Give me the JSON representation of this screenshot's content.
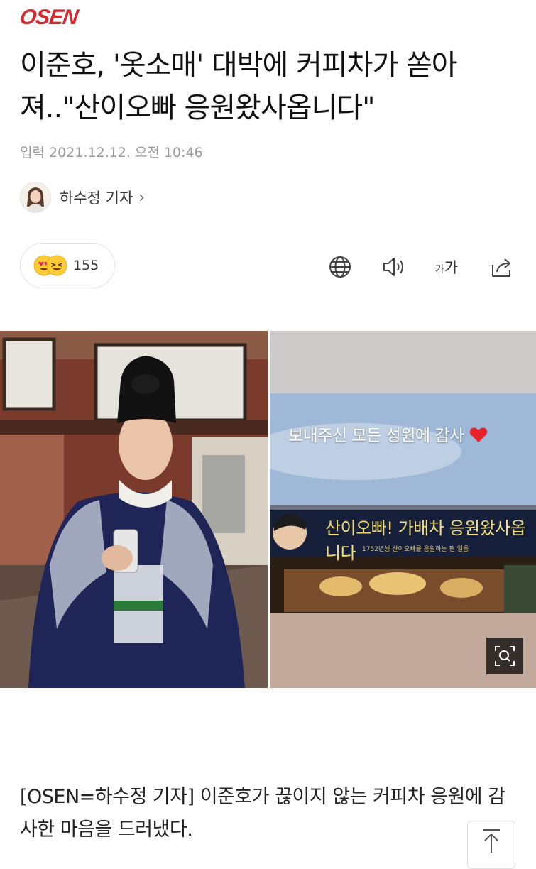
{
  "header": {
    "logo_text": "OSEN",
    "brand_color": "#d7282f"
  },
  "article": {
    "title": "이준호, '옷소매' 대박에 커피차가 쏟아져..\"산이오빠 응원왔사옵니다\"",
    "dateline": "입력 2021.12.12. 오전 10:46",
    "author": {
      "name": "하수정 기자",
      "chevron": "›"
    },
    "reactions": {
      "count": "155",
      "icons": [
        "heart-eyes-emoji-icon",
        "laughing-emoji-icon"
      ]
    },
    "tools": [
      "globe-icon",
      "speaker-icon",
      "font-size-icon",
      "share-icon"
    ],
    "font_size_label": {
      "small": "가",
      "big": "가"
    },
    "photo_right": {
      "caption": "보내주신 모든 성원에 감사",
      "banner_text": "산이오빠! 가배차 응원왔사옵니다",
      "banner_sub": "1752년생 산이오빠를 응원하는 팬 일동"
    },
    "body": "[OSEN=하수정 기자] 이준호가 끊이지 않는 커피차 응원에 감사한 마음을 드러냈다."
  }
}
